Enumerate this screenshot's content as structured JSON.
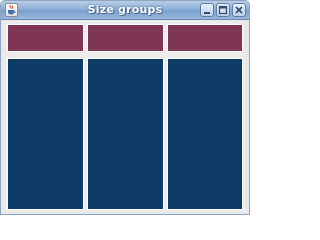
{
  "window": {
    "title": "Size groups",
    "app_icon": "java-coffee-icon",
    "controls": [
      "minimize-icon",
      "maximize-icon",
      "close-icon"
    ]
  },
  "panels": {
    "top_color": "#7f3655",
    "bottom_color": "#0e3a66",
    "columns": 3,
    "rows": 2
  }
}
